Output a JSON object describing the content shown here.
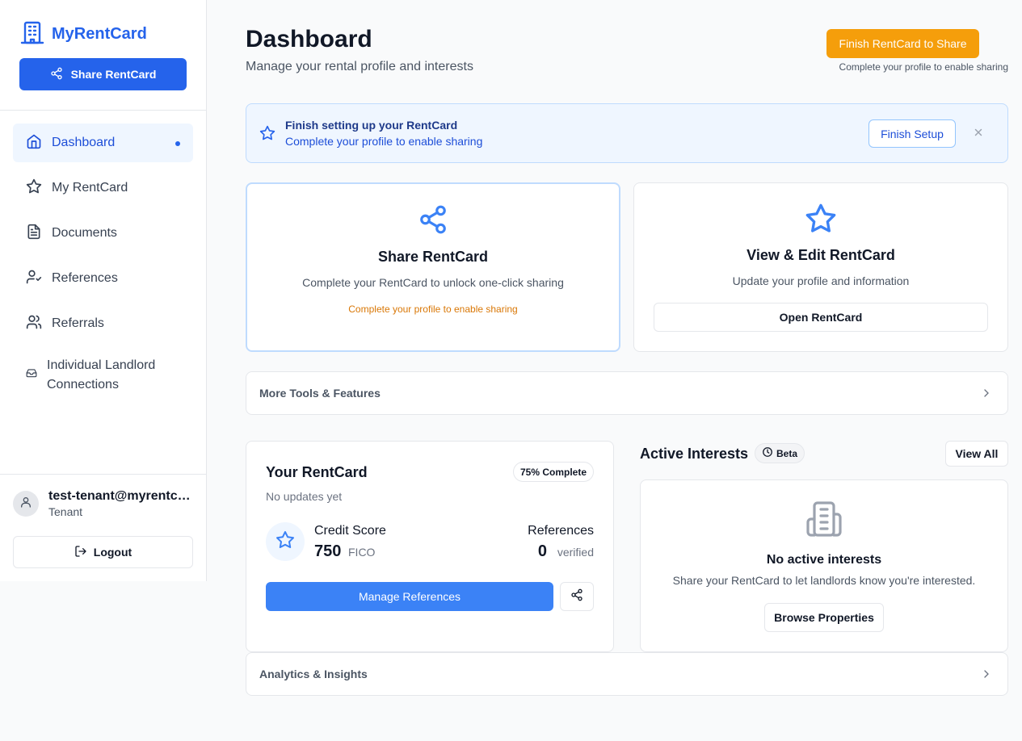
{
  "app": {
    "name": "MyRentCard"
  },
  "sidebar": {
    "share_label": "Share RentCard",
    "items": [
      {
        "label": "Dashboard",
        "icon": "home-icon",
        "active": true
      },
      {
        "label": "My RentCard",
        "icon": "star-icon"
      },
      {
        "label": "Documents",
        "icon": "document-icon"
      },
      {
        "label": "References",
        "icon": "user-check-icon"
      },
      {
        "label": "Referrals",
        "icon": "users-icon"
      },
      {
        "label": "Individual Landlord Connections",
        "icon": "inbox-icon"
      }
    ],
    "user": {
      "email": "test-tenant@myrentcard.com",
      "role": "Tenant"
    },
    "logout_label": "Logout"
  },
  "header": {
    "title": "Dashboard",
    "subtitle": "Manage your rental profile and interests",
    "finish_button": "Finish RentCard to Share",
    "finish_note": "Complete your profile to enable sharing"
  },
  "banner": {
    "title": "Finish setting up your RentCard",
    "subtitle": "Complete your profile to enable sharing",
    "button": "Finish Setup"
  },
  "cards": {
    "share": {
      "title": "Share RentCard",
      "desc": "Complete your RentCard to unlock one-click sharing",
      "warning": "Complete your profile to enable sharing"
    },
    "view": {
      "title": "View & Edit RentCard",
      "desc": "Update your profile and information",
      "button": "Open RentCard"
    }
  },
  "more_tools": {
    "label": "More Tools & Features"
  },
  "rentcard": {
    "title": "Your RentCard",
    "subtitle": "No updates yet",
    "badge": "75% Complete",
    "credit_label": "Credit Score",
    "credit_value": "750",
    "credit_unit": "FICO",
    "ref_label": "References",
    "ref_value": "0",
    "ref_unit": "verified",
    "manage_button": "Manage References"
  },
  "active_interests": {
    "title": "Active Interests",
    "badge": "Beta",
    "view_all": "View All",
    "empty_title": "No active interests",
    "empty_sub": "Share your RentCard to let landlords know you're interested.",
    "browse_button": "Browse Properties"
  },
  "analytics": {
    "label": "Analytics & Insights"
  },
  "colors": {
    "brand": "#2563eb",
    "accent": "#f59e0b",
    "button_blue": "#3b82f6"
  }
}
